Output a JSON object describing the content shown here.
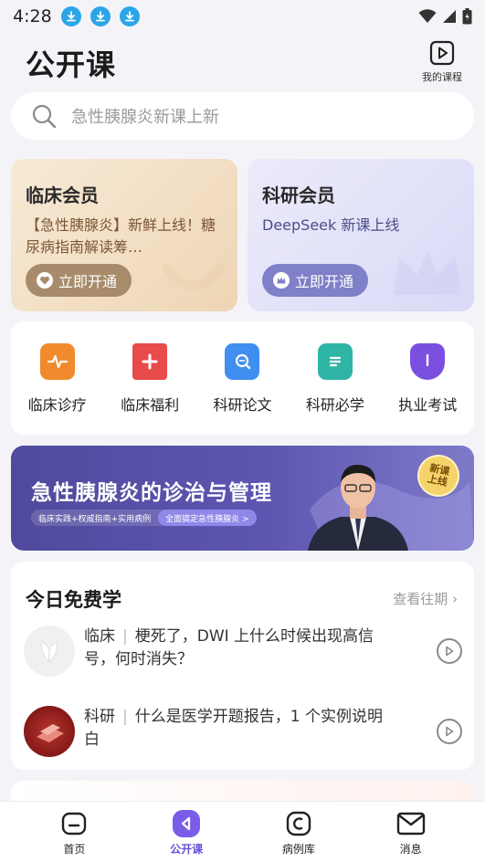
{
  "status_bar": {
    "time": "4:28"
  },
  "header": {
    "title": "公开课",
    "my_course_label": "我的课程"
  },
  "search": {
    "placeholder": "急性胰腺炎新课上新"
  },
  "member_cards": [
    {
      "title": "临床会员",
      "desc": "【急性胰腺炎】新鲜上线！糖尿病指南解读筹…",
      "button": "立即开通"
    },
    {
      "title": "科研会员",
      "desc": "DeepSeek 新课上线",
      "button": "立即开通"
    }
  ],
  "quick_entries": [
    {
      "label": "临床诊疗",
      "icon": "pulse-icon",
      "color": "#f08a2c"
    },
    {
      "label": "临床福利",
      "icon": "gift-plus-icon",
      "color": "#e94a4a"
    },
    {
      "label": "科研论文",
      "icon": "search-paper-icon",
      "color": "#3f8ef0"
    },
    {
      "label": "科研必学",
      "icon": "document-icon",
      "color": "#2fb5a6"
    },
    {
      "label": "执业考试",
      "icon": "certificate-icon",
      "color": "#7a4fe0"
    }
  ],
  "banner": {
    "title": "急性胰腺炎的诊治与管理",
    "tags": "临床实践+权威指南+实用病例",
    "cta": "全面搞定急性胰腺炎 >",
    "badge": "新课上线"
  },
  "free_today": {
    "title": "今日免费学",
    "see_past": "查看往期 ›",
    "lessons": [
      {
        "category": "临床",
        "separator": "|",
        "title": "梗死了，DWI 上什么时候出现高信号，何时消失？"
      },
      {
        "category": "科研",
        "separator": "|",
        "title": "什么是医学开题报告，1 个实例说明白"
      }
    ]
  },
  "tabbar": [
    {
      "label": "首页",
      "active": false
    },
    {
      "label": "公开课",
      "active": true
    },
    {
      "label": "病例库",
      "active": false
    },
    {
      "label": "消息",
      "active": false
    }
  ],
  "colors": {
    "accent": "#6a4fd6",
    "download": "#2aa5e8"
  }
}
